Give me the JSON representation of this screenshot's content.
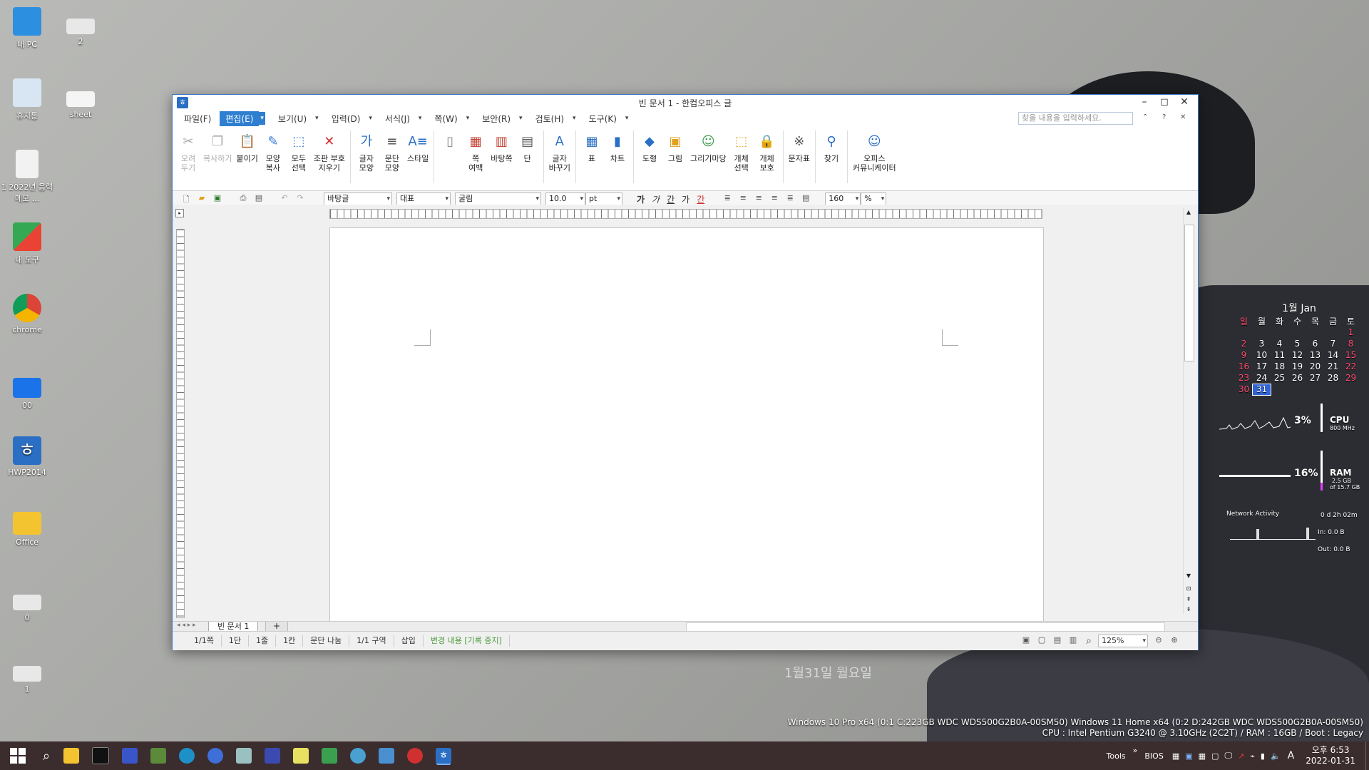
{
  "desktop": {
    "icons": [
      {
        "label": "내 PC",
        "color": "#2d8fe0"
      },
      {
        "label": "휴지통",
        "color": "#d8e6f3"
      },
      {
        "label": "1 2022년 음력 메모 ...",
        "color": "#f2f2f2"
      },
      {
        "label": "내 도구",
        "color": "#34a853"
      },
      {
        "label": "chrome",
        "color": "#db4437"
      },
      {
        "label": "00",
        "color": "#1a73e8"
      },
      {
        "label": "HWP2014",
        "color": "#2a6fc4"
      },
      {
        "label": "Office",
        "color": "#f4c430"
      },
      {
        "label": "0",
        "color": "#e8e8e8"
      },
      {
        "label": "1",
        "color": "#e8e8e8"
      },
      {
        "label": "2",
        "color": "#e8e8e8"
      },
      {
        "label": "sheet",
        "color": "#f5f5f5"
      }
    ],
    "date_text": "1월31일   월요일"
  },
  "window": {
    "title": "빈 문서 1 - 한컴오피스   글",
    "menus": [
      {
        "label": "파일(F)"
      },
      {
        "label": "편집(E)",
        "active": true
      },
      {
        "label": "보기(U)"
      },
      {
        "label": "입력(D)"
      },
      {
        "label": "서식(J)"
      },
      {
        "label": "쪽(W)"
      },
      {
        "label": "보안(R)"
      },
      {
        "label": "검토(H)"
      },
      {
        "label": "도구(K)"
      }
    ],
    "search_placeholder": "찾을 내용을 입력하세요.",
    "ribbon": [
      {
        "label": "오려\n두기",
        "icon": "scissors-icon",
        "disabled": true
      },
      {
        "label": "복사하기",
        "icon": "copy-icon",
        "disabled": true
      },
      {
        "label": "붙이기",
        "icon": "paste-icon"
      },
      {
        "label": "모양\n복사",
        "icon": "format-copy-icon"
      },
      {
        "label": "모두\n선택",
        "icon": "select-all-icon"
      },
      {
        "label": "조판 부호\n지우기",
        "icon": "clear-format-icon"
      },
      {
        "label": "글자\n모양",
        "icon": "char-shape-icon"
      },
      {
        "label": "문단\n모양",
        "icon": "para-shape-icon"
      },
      {
        "label": "스타일",
        "icon": "style-icon"
      },
      {
        "label": "",
        "icon": "page-icon"
      },
      {
        "label": "쪽\n여백",
        "icon": "margin-icon"
      },
      {
        "label": "바탕쪽",
        "icon": "master-page-icon"
      },
      {
        "label": "단",
        "icon": "columns-icon"
      },
      {
        "label": "글자\n바꾸기",
        "icon": "replace-char-icon"
      },
      {
        "label": "표",
        "icon": "table-icon"
      },
      {
        "label": "차트",
        "icon": "chart-icon"
      },
      {
        "label": "도형",
        "icon": "shape-icon"
      },
      {
        "label": "그림",
        "icon": "picture-icon"
      },
      {
        "label": "그리기마당",
        "icon": "clipart-icon"
      },
      {
        "label": "개체\n선택",
        "icon": "object-select-icon"
      },
      {
        "label": "개체\n보호",
        "icon": "object-protect-icon"
      },
      {
        "label": "문자표",
        "icon": "symbol-icon"
      },
      {
        "label": "찾기",
        "icon": "find-icon"
      },
      {
        "label": "오피스\n커뮤니케이터",
        "icon": "communicator-icon"
      }
    ],
    "format_bar": {
      "style": "바탕글",
      "lang": "대표",
      "font": "굴림",
      "size": "10.0",
      "unit": "pt",
      "bold": "가",
      "italic": "가",
      "underline": "간",
      "strike": "가",
      "color_char": "간",
      "line_spacing": "160",
      "percent": "%"
    },
    "doc_tab": "빈 문서 1",
    "add_tab": "+",
    "status": [
      {
        "label": "1/1쪽"
      },
      {
        "label": "1단"
      },
      {
        "label": "1줄"
      },
      {
        "label": "1칸"
      },
      {
        "label": "문단 나눔"
      },
      {
        "label": "1/1 구역"
      },
      {
        "label": "삽입"
      },
      {
        "label": "변경 내용 [기록 중지]",
        "green": true
      }
    ],
    "zoom": "125%"
  },
  "calendar": {
    "month": "1월 Jan",
    "weekdays": [
      "일",
      "월",
      "화",
      "수",
      "목",
      "금",
      "토"
    ],
    "days": [
      "",
      "",
      "",
      "",
      "",
      "",
      "1",
      "2",
      "3",
      "4",
      "5",
      "6",
      "7",
      "8",
      "9",
      "10",
      "11",
      "12",
      "13",
      "14",
      "15",
      "16",
      "17",
      "18",
      "19",
      "20",
      "21",
      "22",
      "23",
      "24",
      "25",
      "26",
      "27",
      "28",
      "29",
      "30",
      "31"
    ],
    "today": "31"
  },
  "meters": {
    "cpu_pct": "3%",
    "cpu_label": "CPU",
    "cpu_freq": "800 MHz",
    "ram_pct": "16%",
    "ram_label": "RAM",
    "ram_used": "2.5 GB",
    "ram_total": "of 15.7 GB",
    "network_label": "Network Activity",
    "uptime": "0 d 2h 02m",
    "net_in": "In: 0.0 B",
    "net_out": "Out: 0.0 B"
  },
  "sysinfo": {
    "line1": "Windows 10 Pro x64 (0:1 C:223GB WDC  WDS500G2B0A-00SM50) Windows 11 Home x64 (0:2 D:242GB WDC  WDS500G2B0A-00SM50)",
    "line2": "CPU : Intel Pentium G3240 @ 3.10GHz (2C2T) / RAM : 16GB / Boot : Legacy"
  },
  "taskbar": {
    "tools_label": "Tools",
    "bios_label": "BIOS",
    "ime": "A",
    "time": "오후 6:53",
    "date": "2022-01-31"
  }
}
